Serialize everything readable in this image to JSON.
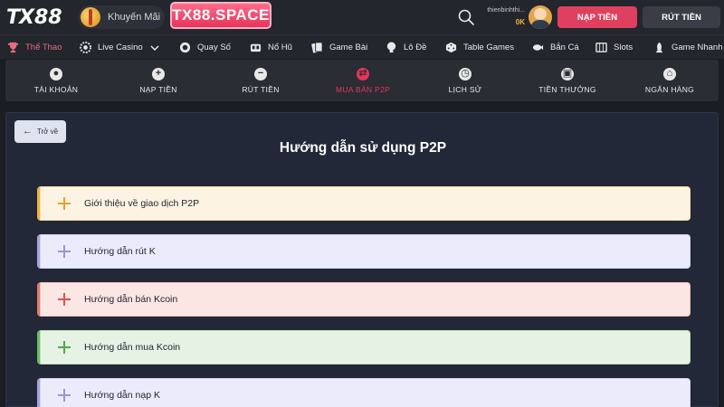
{
  "header": {
    "logo_text": "TX",
    "logo_num": "88",
    "promo_label": "Khuyến Mãi",
    "brand_label": "TX88.SPACE",
    "user_name": "thienbinhthi...",
    "user_balance": "0K",
    "deposit_label": "NẠP TIỀN",
    "withdraw_label": "RÚT TIỀN"
  },
  "categories": [
    {
      "label": "Thể Thao",
      "icon": "trophy-icon",
      "active": true
    },
    {
      "label": "Live Casino",
      "icon": "casino-chip-icon",
      "active": false
    },
    {
      "label": "Quay Số",
      "icon": "lottery-ball-icon",
      "active": false
    },
    {
      "label": "Nổ Hũ",
      "icon": "slot-pot-icon",
      "active": false
    },
    {
      "label": "Game Bài",
      "icon": "cards-icon",
      "active": false
    },
    {
      "label": "Lô Đề",
      "icon": "number-ball-icon",
      "active": false
    },
    {
      "label": "Table Games",
      "icon": "dice-icon",
      "active": false
    },
    {
      "label": "Bắn Cá",
      "icon": "fish-icon",
      "active": false
    },
    {
      "label": "Slots",
      "icon": "slot-machine-icon",
      "active": false
    },
    {
      "label": "Game Nhanh",
      "icon": "rocket-icon",
      "active": false
    }
  ],
  "account_nav": [
    {
      "label": "TÀI KHOẢN",
      "icon": "user-circle-icon",
      "glyph": "●",
      "active": false
    },
    {
      "label": "NẠP TIỀN",
      "icon": "plus-circle-icon",
      "glyph": "+",
      "active": false
    },
    {
      "label": "RÚT TIỀN",
      "icon": "minus-circle-icon",
      "glyph": "−",
      "active": false
    },
    {
      "label": "MUA BÁN P2P",
      "icon": "exchange-icon",
      "glyph": "⇄",
      "active": true
    },
    {
      "label": "LỊCH SỬ",
      "icon": "clock-icon",
      "glyph": "◷",
      "active": false
    },
    {
      "label": "TIỀN THƯỞNG",
      "icon": "gift-icon",
      "glyph": "▣",
      "active": false
    },
    {
      "label": "NGÂN HÀNG",
      "icon": "bank-icon",
      "glyph": "⌂",
      "active": false
    }
  ],
  "main": {
    "back_label": "Trở về",
    "title": "Hướng dẫn sử dụng P2P",
    "guides": [
      {
        "label": "Giới thiệu về giao dịch P2P",
        "bg": "#fdf3e2",
        "border": "#f0b040",
        "plus": "#e8a030"
      },
      {
        "label": "Hướng dẫn rút K",
        "bg": "#ecebfb",
        "border": "#a8a4e0",
        "plus": "#9a96d4"
      },
      {
        "label": "Hướng dẫn bán Kcoin",
        "bg": "#fbe6e3",
        "border": "#e07a6e",
        "plus": "#d9544a"
      },
      {
        "label": "Hướng dẫn mua Kcoin",
        "bg": "#e6f3e4",
        "border": "#6bbd63",
        "plus": "#4ea846"
      },
      {
        "label": "Hướng dẫn nạp K",
        "bg": "#ecebfb",
        "border": "#a8a4e0",
        "plus": "#9a96d4"
      }
    ]
  }
}
